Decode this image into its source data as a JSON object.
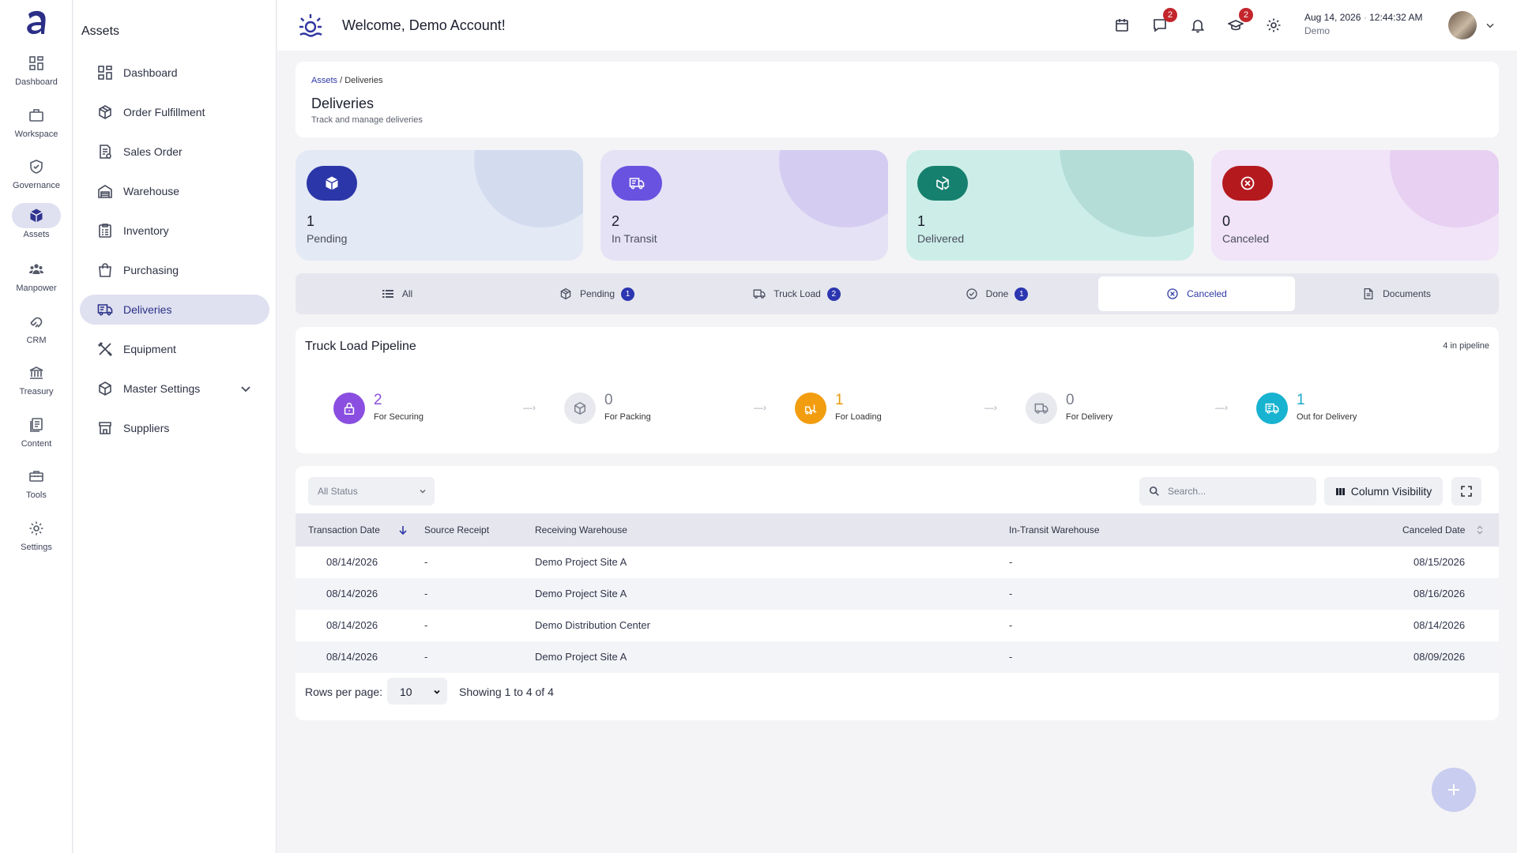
{
  "rail": {
    "items": [
      {
        "label": "Dashboard",
        "icon": "grid-icon"
      },
      {
        "label": "Workspace",
        "icon": "briefcase-icon"
      },
      {
        "label": "Governance",
        "icon": "shield-check-icon"
      },
      {
        "label": "Assets",
        "icon": "cube-icon"
      },
      {
        "label": "Manpower",
        "icon": "people-icon"
      },
      {
        "label": "CRM",
        "icon": "handshake-icon"
      },
      {
        "label": "Treasury",
        "icon": "bank-icon"
      },
      {
        "label": "Content",
        "icon": "document-stack-icon"
      },
      {
        "label": "Tools",
        "icon": "toolbox-icon"
      },
      {
        "label": "Settings",
        "icon": "gear-icon"
      }
    ]
  },
  "sub": {
    "title": "Assets",
    "items": [
      {
        "label": "Dashboard",
        "icon": "grid-icon"
      },
      {
        "label": "Order Fulfillment",
        "icon": "package-icon"
      },
      {
        "label": "Sales Order",
        "icon": "receipt-icon"
      },
      {
        "label": "Warehouse",
        "icon": "warehouse-icon"
      },
      {
        "label": "Inventory",
        "icon": "clipboard-icon"
      },
      {
        "label": "Purchasing",
        "icon": "shopping-bag-icon"
      },
      {
        "label": "Deliveries",
        "icon": "truck-icon"
      },
      {
        "label": "Equipment",
        "icon": "tools-icon"
      },
      {
        "label": "Master Settings",
        "icon": "cube-icon"
      },
      {
        "label": "Suppliers",
        "icon": "store-icon"
      }
    ]
  },
  "header": {
    "welcome": "Welcome, Demo Account!",
    "messages_badge": "2",
    "learning_badge": "2",
    "date": "Aug 14, 2026",
    "time": "12:44:32 AM",
    "user": "Demo"
  },
  "page": {
    "breadcrumb_parent": "Assets",
    "breadcrumb_sep": "/",
    "breadcrumb_current": "Deliveries",
    "title": "Deliveries",
    "subtitle": "Track and manage deliveries"
  },
  "stats": [
    {
      "value": "1",
      "label": "Pending",
      "bg": "#e3e9f5",
      "blob": "#d3dcef",
      "icon_bg": "#2b36a8"
    },
    {
      "value": "2",
      "label": "In Transit",
      "bg": "#e6e2f6",
      "blob": "#d5cdf1",
      "icon_bg": "#6a52e0"
    },
    {
      "value": "1",
      "label": "Delivered",
      "bg": "#cdeee8",
      "blob": "#b5ddd8",
      "icon_bg": "#16806f"
    },
    {
      "value": "0",
      "label": "Canceled",
      "bg": "#f1e3f8",
      "blob": "#e7d0f2",
      "icon_bg": "#b4191e"
    }
  ],
  "tabs": [
    {
      "label": "All",
      "count": ""
    },
    {
      "label": "Pending",
      "count": "1"
    },
    {
      "label": "Truck Load",
      "count": "2"
    },
    {
      "label": "Done",
      "count": "1"
    },
    {
      "label": "Canceled",
      "count": ""
    },
    {
      "label": "Documents",
      "count": ""
    }
  ],
  "pipeline": {
    "title": "Truck Load Pipeline",
    "count_label": "4 in pipeline",
    "arrow": "—›",
    "stages": [
      {
        "value": "2",
        "label": "For Securing",
        "color": "#8a4fe0",
        "icon_bg": "#8a4fe0",
        "icon": "lock-icon"
      },
      {
        "value": "0",
        "label": "For Packing",
        "color": "#7a7e8c",
        "icon_bg": "#e8e9ee",
        "icon": "package-icon"
      },
      {
        "value": "1",
        "label": "For Loading",
        "color": "#e89a0c",
        "icon_bg": "#f29d10",
        "icon": "forklift-icon"
      },
      {
        "value": "0",
        "label": "For Delivery",
        "color": "#7a7e8c",
        "icon_bg": "#e8e9ee",
        "icon": "truck-icon"
      },
      {
        "value": "1",
        "label": "Out for Delivery",
        "color": "#19a9c7",
        "icon_bg": "#17b3d0",
        "icon": "fast-truck-icon"
      }
    ]
  },
  "table": {
    "status_placeholder": "All Status",
    "search_placeholder": "Search...",
    "column_visibility": "Column Visibility",
    "columns": [
      "Transaction Date",
      "Source Receipt",
      "Receiving Warehouse",
      "In-Transit Warehouse",
      "Canceled Date"
    ],
    "rows": [
      [
        "08/14/2026",
        "-",
        "Demo Project Site A",
        "-",
        "08/15/2026"
      ],
      [
        "08/14/2026",
        "-",
        "Demo Project Site A",
        "-",
        "08/16/2026"
      ],
      [
        "08/14/2026",
        "-",
        "Demo Distribution Center",
        "-",
        "08/14/2026"
      ],
      [
        "08/14/2026",
        "-",
        "Demo Project Site A",
        "-",
        "08/09/2026"
      ]
    ],
    "rows_per_page_label": "Rows per page:",
    "rows_per_page": "10",
    "showing": "Showing 1 to 4 of 4"
  }
}
